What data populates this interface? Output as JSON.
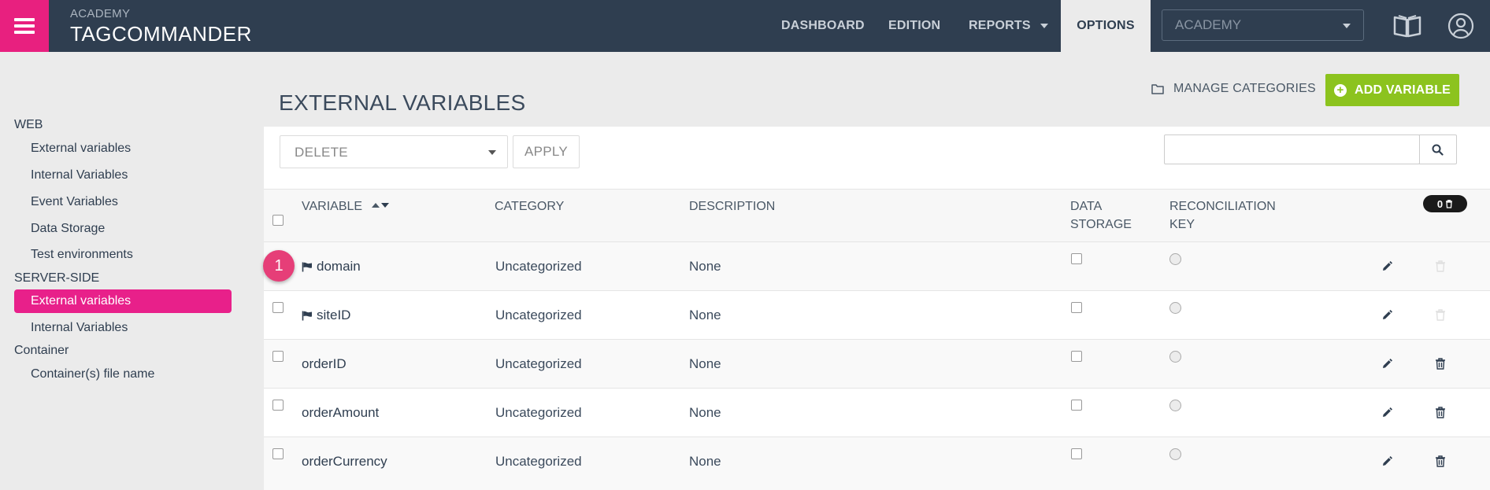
{
  "app": {
    "account_label": "ACADEMY",
    "brand": "TAGCOMMANDER"
  },
  "nav": {
    "dashboard": "DASHBOARD",
    "edition": "EDITION",
    "reports": "REPORTS",
    "options": "OPTIONS"
  },
  "account_select": {
    "value": "ACADEMY"
  },
  "sidebar": {
    "web_heading": "WEB",
    "web_items": [
      "External variables",
      "Internal Variables",
      "Event Variables",
      "Data Storage",
      "Test environments"
    ],
    "server_heading": "SERVER-SIDE",
    "server_items": [
      "External variables",
      "Internal Variables"
    ],
    "container_heading": "Container",
    "container_items": [
      "Container(s) file name"
    ]
  },
  "page": {
    "title": "EXTERNAL VARIABLES",
    "manage_categories": "MANAGE CATEGORIES",
    "add_variable": "ADD VARIABLE"
  },
  "toolbar": {
    "bulk_action": "DELETE",
    "apply": "APPLY",
    "search_value": ""
  },
  "table": {
    "headers": {
      "variable": "VARIABLE",
      "category": "CATEGORY",
      "description": "DESCRIPTION",
      "data_storage_1": "DATA",
      "data_storage_2": "STORAGE",
      "recon_1": "RECONCILIATION",
      "recon_2": "KEY"
    },
    "trash_count": "0",
    "rows": [
      {
        "name": "domain",
        "category": "Uncategorized",
        "description": "None"
      },
      {
        "name": "siteID",
        "category": "Uncategorized",
        "description": "None"
      },
      {
        "name": "orderID",
        "category": "Uncategorized",
        "description": "None"
      },
      {
        "name": "orderAmount",
        "category": "Uncategorized",
        "description": "None"
      },
      {
        "name": "orderCurrency",
        "category": "Uncategorized",
        "description": "None"
      }
    ]
  },
  "annotation": {
    "step": "1"
  },
  "colors": {
    "brand_pink": "#e8207f",
    "topbar": "#2f3e50",
    "add_green": "#8cc31e"
  }
}
